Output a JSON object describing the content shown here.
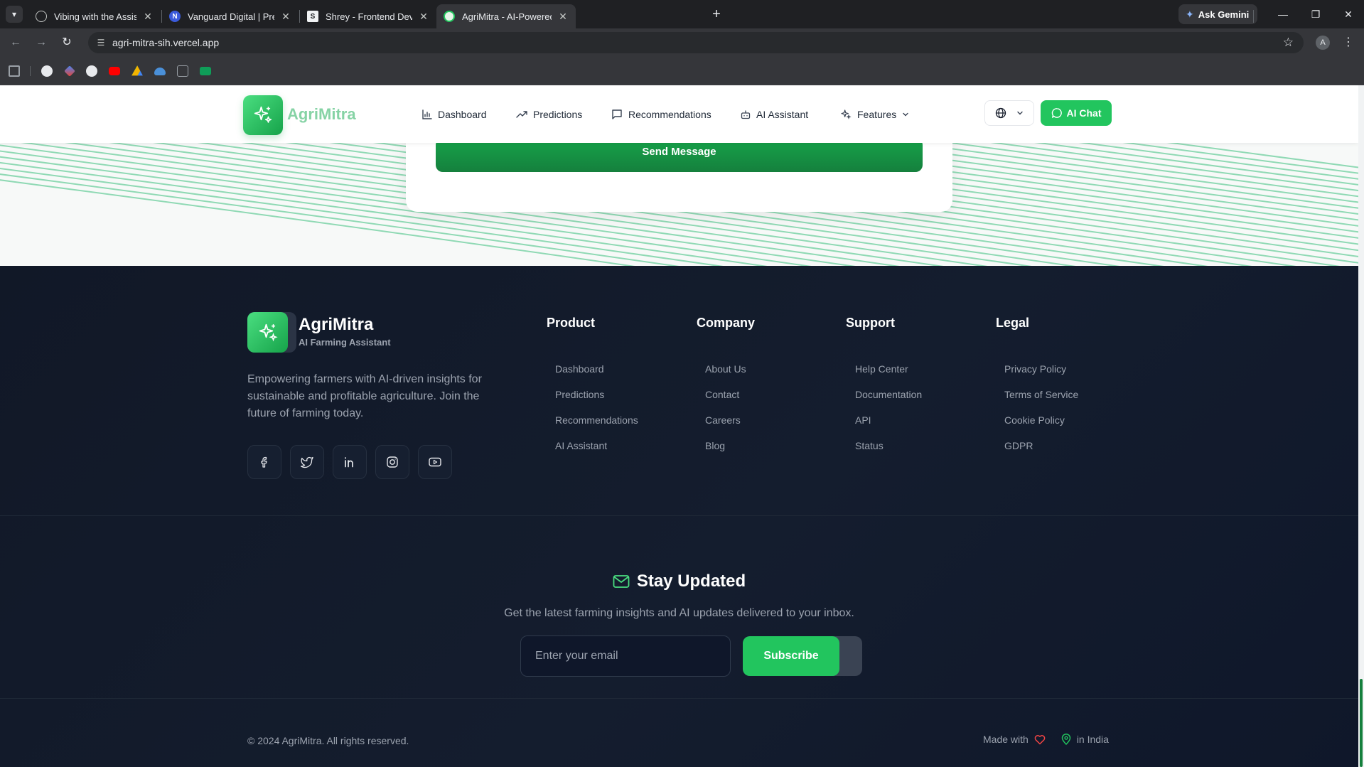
{
  "browser": {
    "tabs": [
      {
        "title": "Vibing with the Assistant",
        "active": false
      },
      {
        "title": "Vanguard Digital | Premium We",
        "active": false
      },
      {
        "title": "Shrey - Frontend Developer & T",
        "active": false
      },
      {
        "title": "AgriMitra - AI-Powered Crop Yi",
        "active": true
      }
    ],
    "gemini_label": "Ask Gemini",
    "url": "agri-mitra-sih.vercel.app",
    "profile_initial": "A"
  },
  "nav": {
    "brand": "AgriMitra",
    "links": [
      {
        "label": "Dashboard",
        "icon": "bar-chart-icon"
      },
      {
        "label": "Predictions",
        "icon": "trending-up-icon"
      },
      {
        "label": "Recommendations",
        "icon": "message-square-icon"
      },
      {
        "label": "AI Assistant",
        "icon": "bot-icon"
      },
      {
        "label": "Features",
        "icon": "sparkles-icon"
      }
    ],
    "ai_chat_label": "AI Chat"
  },
  "contact": {
    "send_label": "Send Message"
  },
  "footer": {
    "brand": "AgriMitra",
    "tagline": "AI Farming Assistant",
    "description": "Empowering farmers with AI-driven insights for sustainable and profitable agriculture. Join the future of farming today.",
    "social": [
      "facebook-icon",
      "twitter-icon",
      "linkedin-icon",
      "instagram-icon",
      "youtube-icon"
    ],
    "columns": [
      {
        "title": "Product",
        "links": [
          "Dashboard",
          "Predictions",
          "Recommendations",
          "AI Assistant"
        ]
      },
      {
        "title": "Company",
        "links": [
          "About Us",
          "Contact",
          "Careers",
          "Blog"
        ]
      },
      {
        "title": "Support",
        "links": [
          "Help Center",
          "Documentation",
          "API",
          "Status"
        ]
      },
      {
        "title": "Legal",
        "links": [
          "Privacy Policy",
          "Terms of Service",
          "Cookie Policy",
          "GDPR"
        ]
      }
    ],
    "newsletter": {
      "title": "Stay Updated",
      "description": "Get the latest farming insights and AI updates delivered to your inbox.",
      "placeholder": "Enter your email",
      "button": "Subscribe"
    },
    "copyright": "© 2024 AgriMitra. All rights reserved.",
    "made_with": "Made with",
    "in_india": "in India"
  },
  "colors": {
    "brand_green": "#22c55e",
    "dark_green": "#15803d",
    "footer_bg": "#111827",
    "heart": "#ef4444"
  }
}
